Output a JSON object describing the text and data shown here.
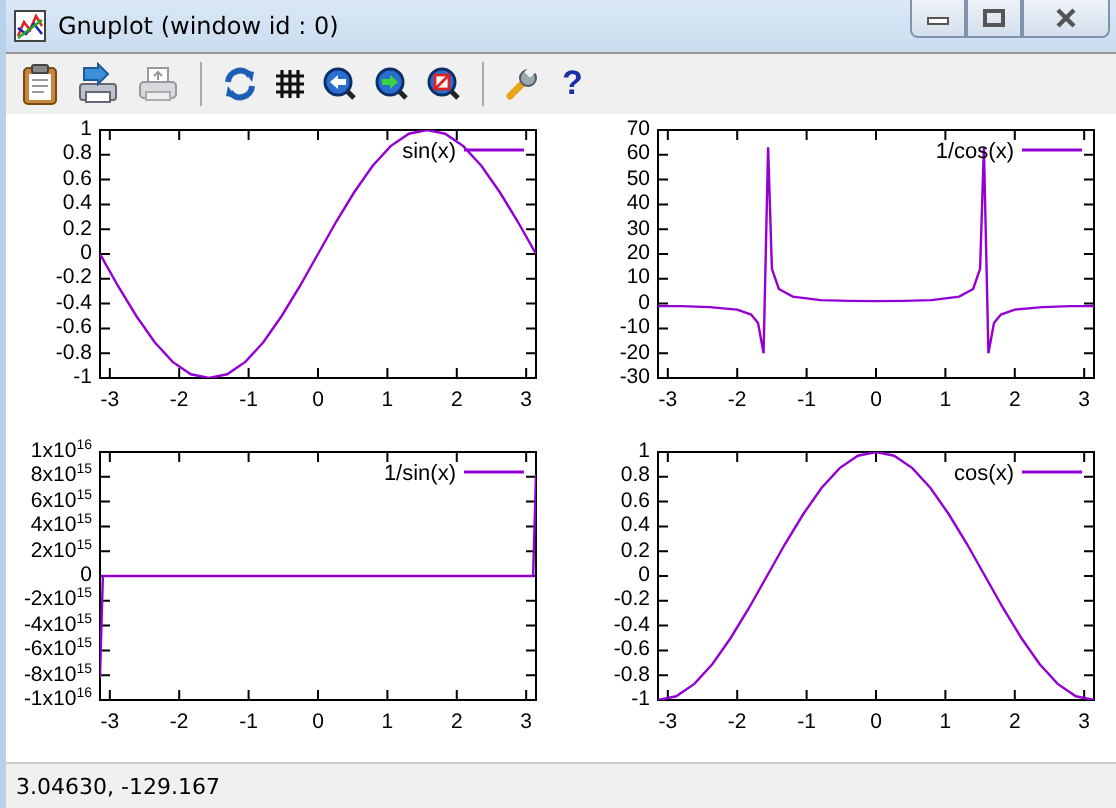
{
  "window": {
    "title": "Gnuplot (window id : 0)"
  },
  "toolbar": {
    "help_label": "?"
  },
  "plots": [
    {
      "chart_data": {
        "type": "line",
        "x": [
          -3.1416,
          -2.8798,
          -2.618,
          -2.3562,
          -2.0944,
          -1.8326,
          -1.5708,
          -1.309,
          -1.0472,
          -0.7854,
          -0.5236,
          -0.2618,
          0,
          0.2618,
          0.5236,
          0.7854,
          1.0472,
          1.309,
          1.5708,
          1.8326,
          2.0944,
          2.3562,
          2.618,
          2.8798,
          3.1416
        ],
        "series": [
          {
            "name": "sin(x)",
            "color": "#9400d3",
            "values": [
              0,
              -0.26,
              -0.5,
              -0.71,
              -0.87,
              -0.97,
              -1,
              -0.97,
              -0.87,
              -0.71,
              -0.5,
              -0.26,
              0,
              0.26,
              0.5,
              0.71,
              0.87,
              0.97,
              1,
              0.97,
              0.87,
              0.71,
              0.5,
              0.26,
              0
            ]
          }
        ],
        "xlim": [
          -3.1416,
          3.1416
        ],
        "ylim": [
          -1,
          1
        ],
        "xticks": [
          -3,
          -2,
          -1,
          0,
          1,
          2,
          3
        ],
        "yticks": [
          -1,
          -0.8,
          -0.6,
          -0.4,
          -0.2,
          0,
          0.2,
          0.4,
          0.6,
          0.8,
          1
        ]
      }
    },
    {
      "chart_data": {
        "type": "line",
        "x": [
          -3.1416,
          -2.8,
          -2.4,
          -2.0,
          -1.8,
          -1.7,
          -1.62,
          -1.555,
          -1.5,
          -1.4,
          -1.2,
          -0.8,
          -0.4,
          0,
          0.4,
          0.8,
          1.2,
          1.4,
          1.5,
          1.555,
          1.62,
          1.7,
          1.8,
          2.0,
          2.4,
          2.8,
          3.1416
        ],
        "series": [
          {
            "name": "1/cos(x)",
            "color": "#9400d3",
            "values": [
              -1,
              -1,
              -1.4,
              -2.4,
              -4.4,
              -7.8,
              -20,
              63,
              14,
              5.9,
              2.8,
              1.4,
              1.1,
              1,
              1.1,
              1.4,
              2.8,
              5.9,
              14,
              63,
              -20,
              -7.8,
              -4.4,
              -2.4,
              -1.4,
              -1,
              -1
            ]
          }
        ],
        "xlim": [
          -3.1416,
          3.1416
        ],
        "ylim": [
          -30,
          70
        ],
        "xticks": [
          -3,
          -2,
          -1,
          0,
          1,
          2,
          3
        ],
        "yticks": [
          -30,
          -20,
          -10,
          0,
          10,
          20,
          30,
          40,
          50,
          60,
          70
        ]
      }
    },
    {
      "chart_data": {
        "type": "line",
        "x": [
          -3.1416,
          -3.1,
          -2.5,
          -2,
          -1.5,
          -1,
          -0.5,
          0.5,
          1,
          1.5,
          2,
          2.5,
          3.1,
          3.1416
        ],
        "series": [
          {
            "name": "1/sin(x)",
            "color": "#9400d3",
            "values": [
              -8200000000000000,
              -24,
              -1.7,
              -1.1,
              -1,
              -1.2,
              -2.1,
              2.1,
              1.2,
              1,
              1.1,
              1.7,
              24,
              8200000000000000
            ]
          }
        ],
        "xlim": [
          -3.1416,
          3.1416
        ],
        "ylim": [
          -10000000000000000,
          10000000000000000
        ],
        "xticks": [
          -3,
          -2,
          -1,
          0,
          1,
          2,
          3
        ],
        "yticks": [
          {
            "value": -10000000000000000,
            "label": "-1x10$^{16}$"
          },
          {
            "value": -8000000000000000,
            "label": "-8x10$^{15}$"
          },
          {
            "value": -6000000000000000,
            "label": "-6x10$^{15}$"
          },
          {
            "value": -4000000000000000,
            "label": "-4x10$^{15}$"
          },
          {
            "value": -2000000000000000,
            "label": "-2x10$^{15}$"
          },
          {
            "value": 0,
            "label": "0"
          },
          {
            "value": 2000000000000000,
            "label": "2x10$^{15}$"
          },
          {
            "value": 4000000000000000,
            "label": "4x10$^{15}$"
          },
          {
            "value": 6000000000000000,
            "label": "6x10$^{15}$"
          },
          {
            "value": 8000000000000000,
            "label": "8x10$^{15}$"
          },
          {
            "value": 10000000000000000,
            "label": "1x10$^{16}$"
          }
        ]
      }
    },
    {
      "chart_data": {
        "type": "line",
        "x": [
          -3.1416,
          -2.8798,
          -2.618,
          -2.3562,
          -2.0944,
          -1.8326,
          -1.5708,
          -1.309,
          -1.0472,
          -0.7854,
          -0.5236,
          -0.2618,
          0,
          0.2618,
          0.5236,
          0.7854,
          1.0472,
          1.309,
          1.5708,
          1.8326,
          2.0944,
          2.3562,
          2.618,
          2.8798,
          3.1416
        ],
        "series": [
          {
            "name": "cos(x)",
            "color": "#9400d3",
            "values": [
              -1,
              -0.97,
              -0.87,
              -0.71,
              -0.5,
              -0.26,
              0,
              0.26,
              0.5,
              0.71,
              0.87,
              0.97,
              1,
              0.97,
              0.87,
              0.71,
              0.5,
              0.26,
              0,
              -0.26,
              -0.5,
              -0.71,
              -0.87,
              -0.97,
              -1
            ]
          }
        ],
        "xlim": [
          -3.1416,
          3.1416
        ],
        "ylim": [
          -1,
          1
        ],
        "xticks": [
          -3,
          -2,
          -1,
          0,
          1,
          2,
          3
        ],
        "yticks": [
          -1,
          -0.8,
          -0.6,
          -0.4,
          -0.2,
          0,
          0.2,
          0.4,
          0.6,
          0.8,
          1
        ]
      }
    }
  ],
  "status_bar": {
    "text": "3.04630, -129.167"
  }
}
